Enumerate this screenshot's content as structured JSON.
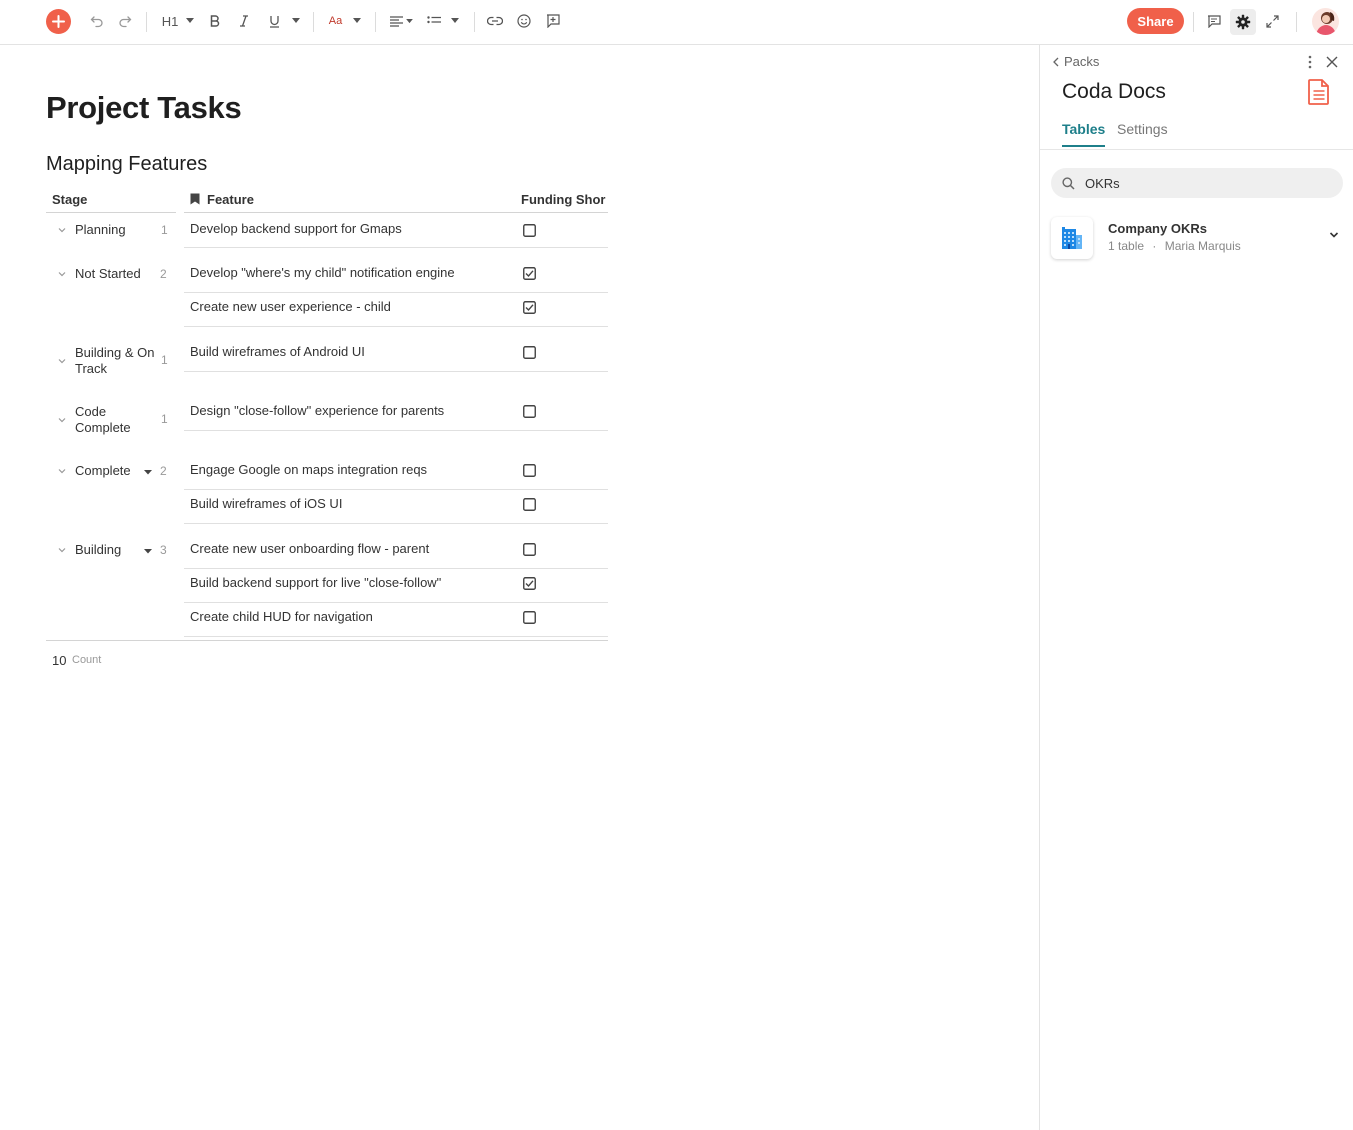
{
  "toolbar": {
    "heading_label": "H1",
    "font_label": "Aa",
    "share_label": "Share"
  },
  "doc": {
    "title": "Project Tasks",
    "section_title": "Mapping Features"
  },
  "table": {
    "columns": [
      "Stage",
      "Feature",
      "Funding Shor"
    ],
    "groups": [
      {
        "stage": "Planning",
        "count": "1",
        "rows": [
          {
            "feature": "Develop backend support for Gmaps",
            "checked": false
          }
        ]
      },
      {
        "stage": "Not Started",
        "count": "2",
        "rows": [
          {
            "feature": "Develop \"where's my child\" notification engine",
            "checked": true
          },
          {
            "feature": "Create new user experience - child",
            "checked": true
          }
        ]
      },
      {
        "stage": "Building & On Track",
        "count": "1",
        "rows": [
          {
            "feature": "Build wireframes of Android UI",
            "checked": false
          }
        ]
      },
      {
        "stage": "Code Complete",
        "count": "1",
        "rows": [
          {
            "feature": "Design \"close-follow\" experience for parents",
            "checked": false
          }
        ]
      },
      {
        "stage": "Complete",
        "count": "2",
        "rows": [
          {
            "feature": "Engage Google on maps integration reqs",
            "checked": false
          },
          {
            "feature": "Build wireframes of iOS UI",
            "checked": false
          }
        ]
      },
      {
        "stage": "Building",
        "count": "3",
        "rows": [
          {
            "feature": "Create new user onboarding flow - parent",
            "checked": false
          },
          {
            "feature": "Build backend support for live \"close-follow\"",
            "checked": true
          },
          {
            "feature": "Create child HUD for navigation",
            "checked": false
          }
        ]
      }
    ],
    "footer": {
      "count": "10",
      "label": "Count"
    }
  },
  "panel": {
    "back_label": "Packs",
    "title": "Coda Docs",
    "tabs": [
      "Tables",
      "Settings"
    ],
    "search_value": "OKRs",
    "item": {
      "name": "Company OKRs",
      "tables": "1 table",
      "separator": "·",
      "owner": "Maria Marquis"
    }
  },
  "colors": {
    "accent": "#f0604a",
    "tab_active": "#1e7f8a"
  }
}
